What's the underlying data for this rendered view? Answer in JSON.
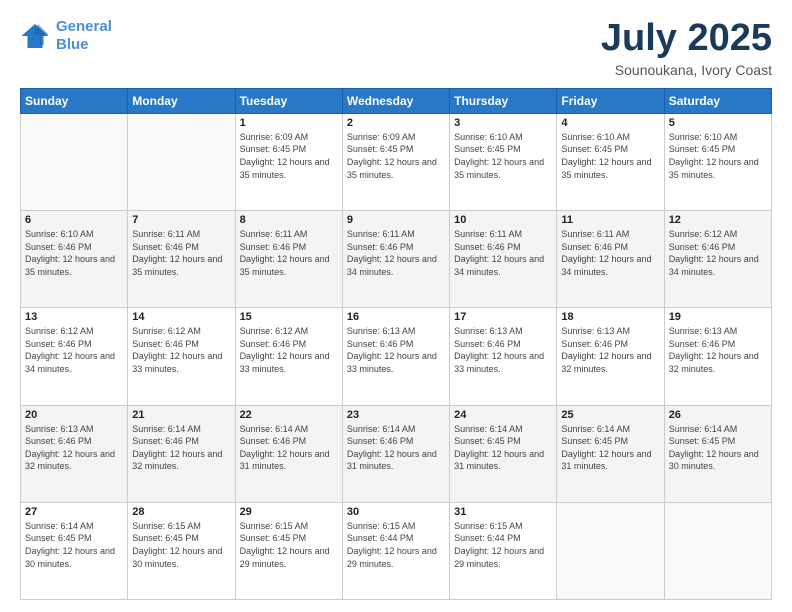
{
  "logo": {
    "line1": "General",
    "line2": "Blue"
  },
  "title": "July 2025",
  "subtitle": "Sounoukana, Ivory Coast",
  "weekdays": [
    "Sunday",
    "Monday",
    "Tuesday",
    "Wednesday",
    "Thursday",
    "Friday",
    "Saturday"
  ],
  "weeks": [
    [
      {
        "num": "",
        "sunrise": "",
        "sunset": "",
        "daylight": ""
      },
      {
        "num": "",
        "sunrise": "",
        "sunset": "",
        "daylight": ""
      },
      {
        "num": "1",
        "sunrise": "Sunrise: 6:09 AM",
        "sunset": "Sunset: 6:45 PM",
        "daylight": "Daylight: 12 hours and 35 minutes."
      },
      {
        "num": "2",
        "sunrise": "Sunrise: 6:09 AM",
        "sunset": "Sunset: 6:45 PM",
        "daylight": "Daylight: 12 hours and 35 minutes."
      },
      {
        "num": "3",
        "sunrise": "Sunrise: 6:10 AM",
        "sunset": "Sunset: 6:45 PM",
        "daylight": "Daylight: 12 hours and 35 minutes."
      },
      {
        "num": "4",
        "sunrise": "Sunrise: 6:10 AM",
        "sunset": "Sunset: 6:45 PM",
        "daylight": "Daylight: 12 hours and 35 minutes."
      },
      {
        "num": "5",
        "sunrise": "Sunrise: 6:10 AM",
        "sunset": "Sunset: 6:45 PM",
        "daylight": "Daylight: 12 hours and 35 minutes."
      }
    ],
    [
      {
        "num": "6",
        "sunrise": "Sunrise: 6:10 AM",
        "sunset": "Sunset: 6:46 PM",
        "daylight": "Daylight: 12 hours and 35 minutes."
      },
      {
        "num": "7",
        "sunrise": "Sunrise: 6:11 AM",
        "sunset": "Sunset: 6:46 PM",
        "daylight": "Daylight: 12 hours and 35 minutes."
      },
      {
        "num": "8",
        "sunrise": "Sunrise: 6:11 AM",
        "sunset": "Sunset: 6:46 PM",
        "daylight": "Daylight: 12 hours and 35 minutes."
      },
      {
        "num": "9",
        "sunrise": "Sunrise: 6:11 AM",
        "sunset": "Sunset: 6:46 PM",
        "daylight": "Daylight: 12 hours and 34 minutes."
      },
      {
        "num": "10",
        "sunrise": "Sunrise: 6:11 AM",
        "sunset": "Sunset: 6:46 PM",
        "daylight": "Daylight: 12 hours and 34 minutes."
      },
      {
        "num": "11",
        "sunrise": "Sunrise: 6:11 AM",
        "sunset": "Sunset: 6:46 PM",
        "daylight": "Daylight: 12 hours and 34 minutes."
      },
      {
        "num": "12",
        "sunrise": "Sunrise: 6:12 AM",
        "sunset": "Sunset: 6:46 PM",
        "daylight": "Daylight: 12 hours and 34 minutes."
      }
    ],
    [
      {
        "num": "13",
        "sunrise": "Sunrise: 6:12 AM",
        "sunset": "Sunset: 6:46 PM",
        "daylight": "Daylight: 12 hours and 34 minutes."
      },
      {
        "num": "14",
        "sunrise": "Sunrise: 6:12 AM",
        "sunset": "Sunset: 6:46 PM",
        "daylight": "Daylight: 12 hours and 33 minutes."
      },
      {
        "num": "15",
        "sunrise": "Sunrise: 6:12 AM",
        "sunset": "Sunset: 6:46 PM",
        "daylight": "Daylight: 12 hours and 33 minutes."
      },
      {
        "num": "16",
        "sunrise": "Sunrise: 6:13 AM",
        "sunset": "Sunset: 6:46 PM",
        "daylight": "Daylight: 12 hours and 33 minutes."
      },
      {
        "num": "17",
        "sunrise": "Sunrise: 6:13 AM",
        "sunset": "Sunset: 6:46 PM",
        "daylight": "Daylight: 12 hours and 33 minutes."
      },
      {
        "num": "18",
        "sunrise": "Sunrise: 6:13 AM",
        "sunset": "Sunset: 6:46 PM",
        "daylight": "Daylight: 12 hours and 32 minutes."
      },
      {
        "num": "19",
        "sunrise": "Sunrise: 6:13 AM",
        "sunset": "Sunset: 6:46 PM",
        "daylight": "Daylight: 12 hours and 32 minutes."
      }
    ],
    [
      {
        "num": "20",
        "sunrise": "Sunrise: 6:13 AM",
        "sunset": "Sunset: 6:46 PM",
        "daylight": "Daylight: 12 hours and 32 minutes."
      },
      {
        "num": "21",
        "sunrise": "Sunrise: 6:14 AM",
        "sunset": "Sunset: 6:46 PM",
        "daylight": "Daylight: 12 hours and 32 minutes."
      },
      {
        "num": "22",
        "sunrise": "Sunrise: 6:14 AM",
        "sunset": "Sunset: 6:46 PM",
        "daylight": "Daylight: 12 hours and 31 minutes."
      },
      {
        "num": "23",
        "sunrise": "Sunrise: 6:14 AM",
        "sunset": "Sunset: 6:46 PM",
        "daylight": "Daylight: 12 hours and 31 minutes."
      },
      {
        "num": "24",
        "sunrise": "Sunrise: 6:14 AM",
        "sunset": "Sunset: 6:45 PM",
        "daylight": "Daylight: 12 hours and 31 minutes."
      },
      {
        "num": "25",
        "sunrise": "Sunrise: 6:14 AM",
        "sunset": "Sunset: 6:45 PM",
        "daylight": "Daylight: 12 hours and 31 minutes."
      },
      {
        "num": "26",
        "sunrise": "Sunrise: 6:14 AM",
        "sunset": "Sunset: 6:45 PM",
        "daylight": "Daylight: 12 hours and 30 minutes."
      }
    ],
    [
      {
        "num": "27",
        "sunrise": "Sunrise: 6:14 AM",
        "sunset": "Sunset: 6:45 PM",
        "daylight": "Daylight: 12 hours and 30 minutes."
      },
      {
        "num": "28",
        "sunrise": "Sunrise: 6:15 AM",
        "sunset": "Sunset: 6:45 PM",
        "daylight": "Daylight: 12 hours and 30 minutes."
      },
      {
        "num": "29",
        "sunrise": "Sunrise: 6:15 AM",
        "sunset": "Sunset: 6:45 PM",
        "daylight": "Daylight: 12 hours and 29 minutes."
      },
      {
        "num": "30",
        "sunrise": "Sunrise: 6:15 AM",
        "sunset": "Sunset: 6:44 PM",
        "daylight": "Daylight: 12 hours and 29 minutes."
      },
      {
        "num": "31",
        "sunrise": "Sunrise: 6:15 AM",
        "sunset": "Sunset: 6:44 PM",
        "daylight": "Daylight: 12 hours and 29 minutes."
      },
      {
        "num": "",
        "sunrise": "",
        "sunset": "",
        "daylight": ""
      },
      {
        "num": "",
        "sunrise": "",
        "sunset": "",
        "daylight": ""
      }
    ]
  ]
}
